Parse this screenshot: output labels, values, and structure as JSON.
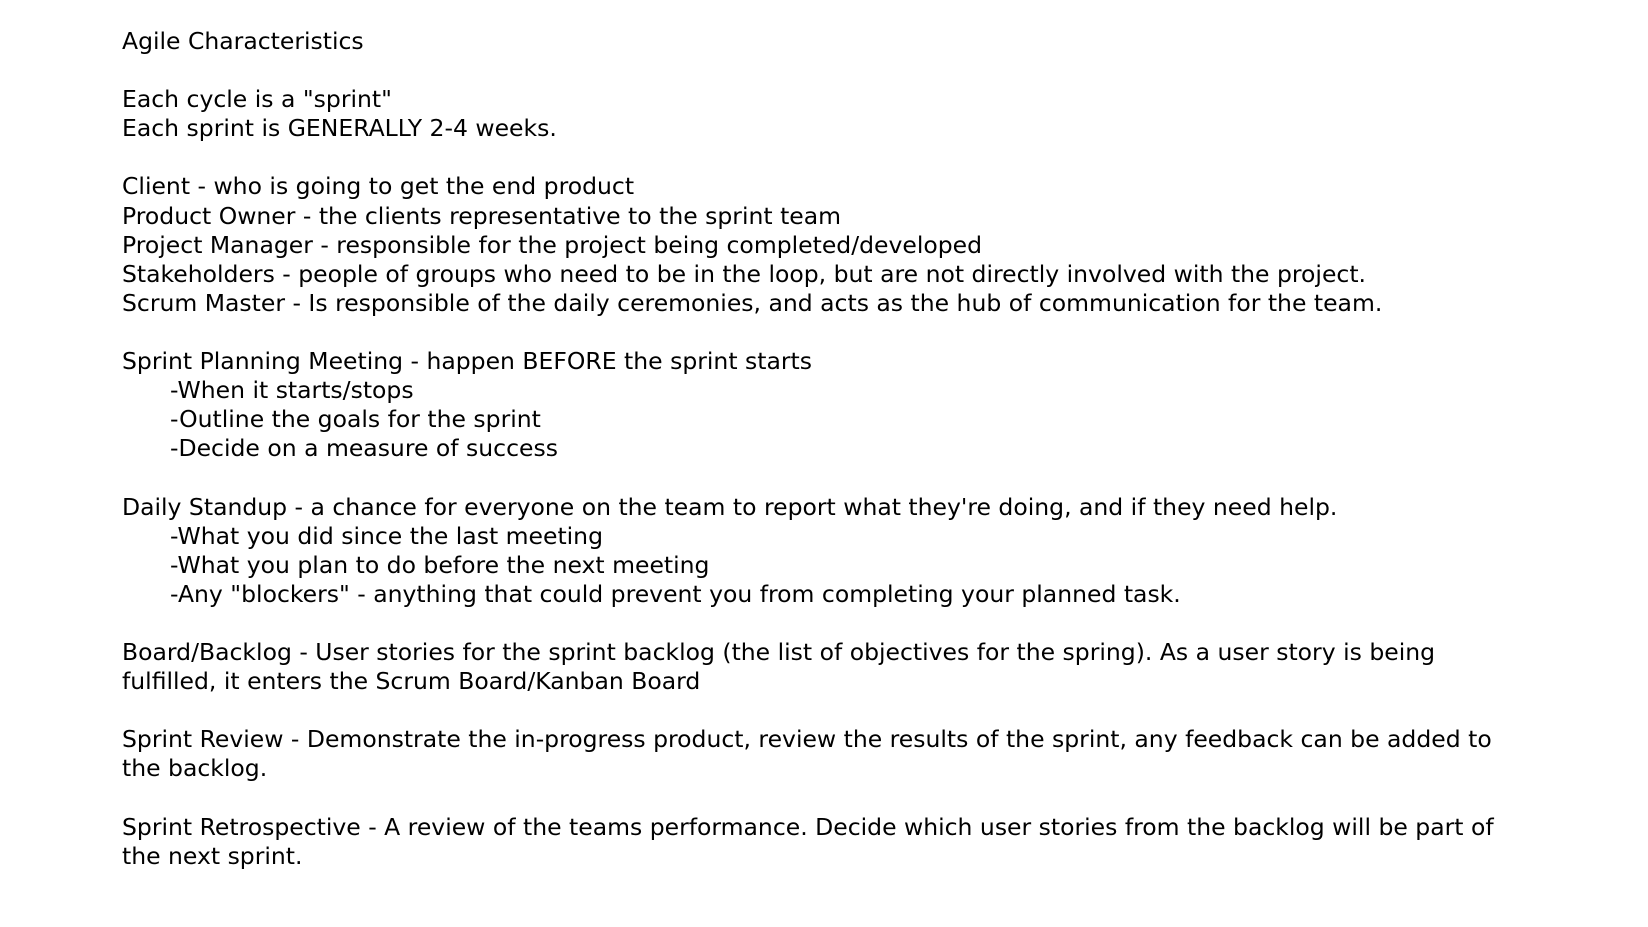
{
  "title": "Agile Characteristics",
  "intro": [
    "Each cycle is a \"sprint\"",
    "Each sprint is GENERALLY 2-4 weeks."
  ],
  "roles": [
    "Client - who is going to get the end product",
    "Product Owner - the clients representative to the sprint team",
    "Project Manager - responsible for the project being completed/developed",
    "Stakeholders - people of groups who need to be in the loop, but are not directly involved with the project.",
    "Scrum Master - Is responsible of the daily ceremonies, and acts as the hub of communication for the team."
  ],
  "planning": {
    "heading": "Sprint Planning Meeting - happen BEFORE the sprint starts",
    "items": [
      "-When it starts/stops",
      "-Outline the goals for the sprint",
      "-Decide on a measure of success"
    ]
  },
  "standup": {
    "heading": "Daily Standup - a chance for everyone on the team to report what they're doing, and if they need help.",
    "items": [
      "-What you did since the last meeting",
      "-What you plan to do before the next meeting",
      "-Any \"blockers\" - anything that could prevent you from completing your planned task."
    ]
  },
  "backlog": "Board/Backlog - User stories for the sprint backlog (the list of objectives for the spring). As a user story is being fulfilled, it enters the Scrum Board/Kanban Board",
  "review": "Sprint Review - Demonstrate the in-progress product, review the results of the sprint, any feedback can be added to the backlog.",
  "retrospective": "Sprint Retrospective - A review of the teams performance. Decide which user stories from the backlog will be part of the next sprint."
}
